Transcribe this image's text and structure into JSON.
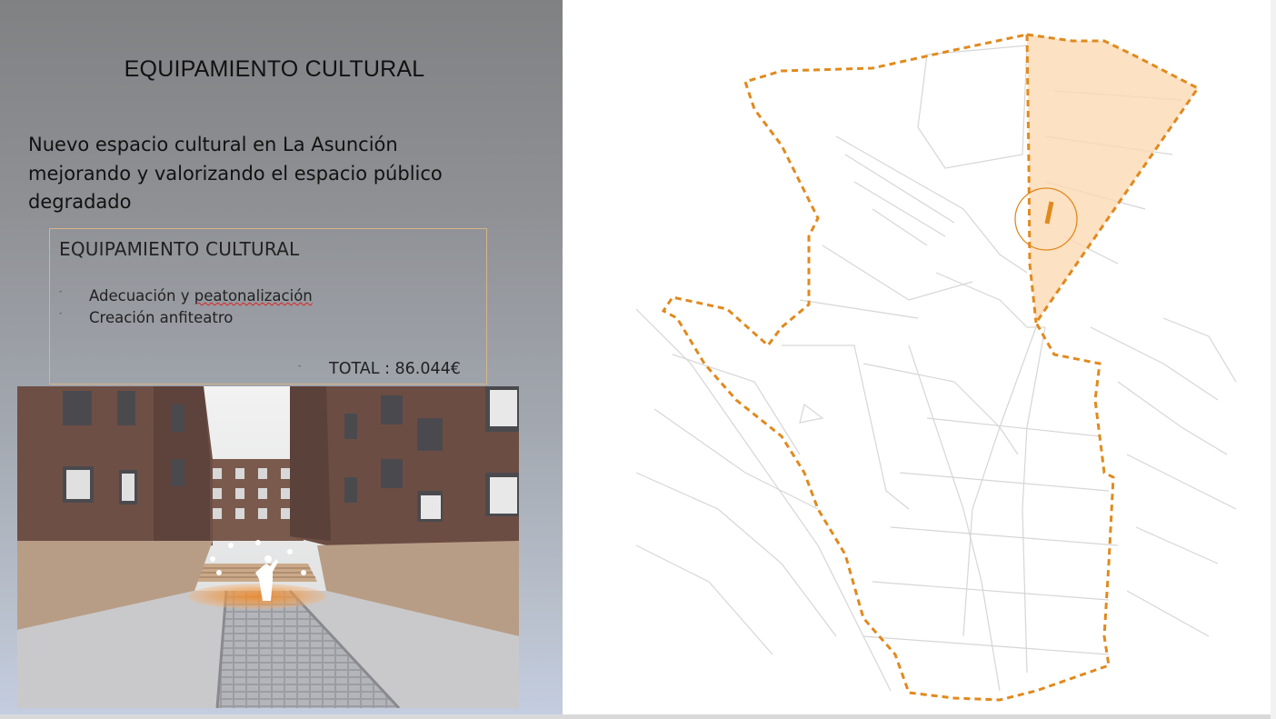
{
  "slide": {
    "title": "EQUIPAMIENTO CULTURAL",
    "subtitle_lines": [
      "Nuevo espacio cultural en La Asunción",
      "mejorando y valorizando el espacio público",
      "degradado"
    ]
  },
  "box": {
    "title": "EQUIPAMIENTO CULTURAL",
    "bullet_marker": "-",
    "items": [
      {
        "pre": "Adecuación y ",
        "misspelled": "peatonalización"
      },
      {
        "pre": "Creación anfiteatro",
        "misspelled": ""
      }
    ],
    "total": "TOTAL : 86.044€"
  },
  "colors": {
    "accent_orange": "#e08a1e",
    "zone_fill": "#fbd9b4",
    "street_lines": "#d6d6d6"
  },
  "icons": {
    "location_marker": "circle-marker-icon"
  }
}
